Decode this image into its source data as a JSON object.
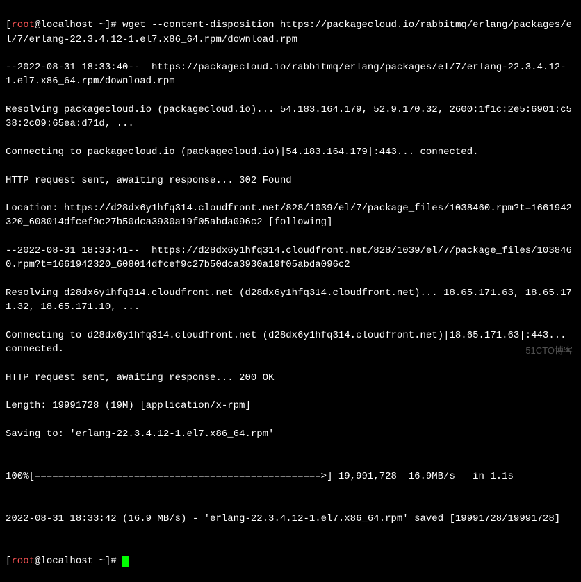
{
  "prompt": {
    "user": "root",
    "host": "localhost",
    "path": "~",
    "symbol": "#"
  },
  "command": "wget --content-disposition https://packagecloud.io/rabbitmq/erlang/packages/el/7/erlang-22.3.4.12-1.el7.x86_64.rpm/download.rpm",
  "output": {
    "line1": "--2022-08-31 18:33:40--  https://packagecloud.io/rabbitmq/erlang/packages/el/7/erlang-22.3.4.12-1.el7.x86_64.rpm/download.rpm",
    "line2": "Resolving packagecloud.io (packagecloud.io)... 54.183.164.179, 52.9.170.32, 2600:1f1c:2e5:6901:c538:2c09:65ea:d71d, ...",
    "line3": "Connecting to packagecloud.io (packagecloud.io)|54.183.164.179|:443... connected.",
    "line4": "HTTP request sent, awaiting response... 302 Found",
    "line5": "Location: https://d28dx6y1hfq314.cloudfront.net/828/1039/el/7/package_files/1038460.rpm?t=1661942320_608014dfcef9c27b50dca3930a19f05abda096c2 [following]",
    "line6": "--2022-08-31 18:33:41--  https://d28dx6y1hfq314.cloudfront.net/828/1039/el/7/package_files/1038460.rpm?t=1661942320_608014dfcef9c27b50dca3930a19f05abda096c2",
    "line7": "Resolving d28dx6y1hfq314.cloudfront.net (d28dx6y1hfq314.cloudfront.net)... 18.65.171.63, 18.65.171.32, 18.65.171.10, ...",
    "line8": "Connecting to d28dx6y1hfq314.cloudfront.net (d28dx6y1hfq314.cloudfront.net)|18.65.171.63|:443... connected.",
    "line9": "HTTP request sent, awaiting response... 200 OK",
    "line10": "Length: 19991728 (19M) [application/x-rpm]",
    "line11": "Saving to: 'erlang-22.3.4.12-1.el7.x86_64.rpm'",
    "blank1": "",
    "progress": "100%[=================================================>] 19,991,728  16.9MB/s   in 1.1s",
    "blank2": "",
    "saved": "2022-08-31 18:33:42 (16.9 MB/s) - 'erlang-22.3.4.12-1.el7.x86_64.rpm' saved [19991728/19991728]",
    "blank3": ""
  },
  "watermark": "51CTO博客"
}
